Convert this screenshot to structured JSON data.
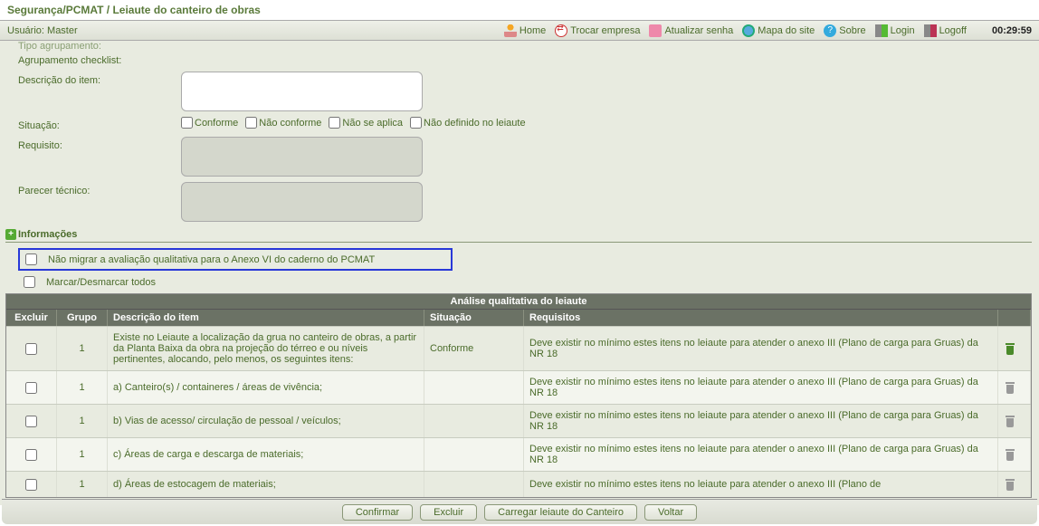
{
  "breadcrumb": "Segurança/PCMAT / Leiaute do canteiro de obras",
  "user_label": "Usuário:",
  "user_name": "Master",
  "nav": {
    "home": "Home",
    "trocar": "Trocar empresa",
    "atualizar": "Atualizar senha",
    "mapa": "Mapa do site",
    "sobre": "Sobre",
    "login": "Login",
    "logoff": "Logoff"
  },
  "clock": "00:29:59",
  "fields": {
    "tipo_agrupamento": "Tipo agrupamento:",
    "agrupamento_checklist": "Agrupamento checklist:",
    "descricao_item": "Descrição do item:",
    "situacao": "Situação:",
    "requisito": "Requisito:",
    "parecer": "Parecer técnico:"
  },
  "situacao_opts": {
    "conforme": "Conforme",
    "nao_conforme": "Não conforme",
    "nao_aplica": "Não se aplica",
    "nao_definido": "Não definido no leiaute"
  },
  "section_info": "Informações",
  "chk_nao_migrar": "Não migrar a avaliação qualitativa para o Anexo VI do caderno do PCMAT",
  "chk_marcar": "Marcar/Desmarcar todos",
  "table": {
    "title": "Análise qualitativa do leiaute",
    "headers": {
      "excluir": "Excluir",
      "grupo": "Grupo",
      "descricao": "Descrição do item",
      "situacao": "Situação",
      "requisitos": "Requisitos"
    },
    "rows": [
      {
        "grupo": "1",
        "desc": "Existe no Leiaute a localização da grua no canteiro de obras, a partir da Planta Baixa da obra na projeção do térreo e ou níveis pertinentes, alocando, pelo menos, os seguintes itens:",
        "sit": "Conforme",
        "req": "Deve existir no mínimo estes itens no leiaute para atender o anexo III (Plano de carga para Gruas) da NR 18",
        "trash": "green"
      },
      {
        "grupo": "1",
        "desc": "a) Canteiro(s) / containeres / áreas de vivência;",
        "sit": "",
        "req": "Deve existir no mínimo estes itens no leiaute para atender o anexo III (Plano de carga para Gruas) da NR 18",
        "trash": "gray"
      },
      {
        "grupo": "1",
        "desc": "b) Vias de acesso/ circulação de pessoal / veículos;",
        "sit": "",
        "req": "Deve existir no mínimo estes itens no leiaute para atender o anexo III (Plano de carga para Gruas) da NR 18",
        "trash": "gray"
      },
      {
        "grupo": "1",
        "desc": "c) Áreas de carga e descarga de materiais;",
        "sit": "",
        "req": "Deve existir no mínimo estes itens no leiaute para atender o anexo III (Plano de carga para Gruas) da NR 18",
        "trash": "gray"
      },
      {
        "grupo": "1",
        "desc": "d) Áreas de estocagem de materiais;",
        "sit": "",
        "req": "Deve existir no mínimo estes itens no leiaute para atender o anexo III (Plano de",
        "trash": "gray"
      }
    ]
  },
  "buttons": {
    "confirmar": "Confirmar",
    "excluir": "Excluir",
    "carregar": "Carregar leiaute do Canteiro",
    "voltar": "Voltar"
  }
}
